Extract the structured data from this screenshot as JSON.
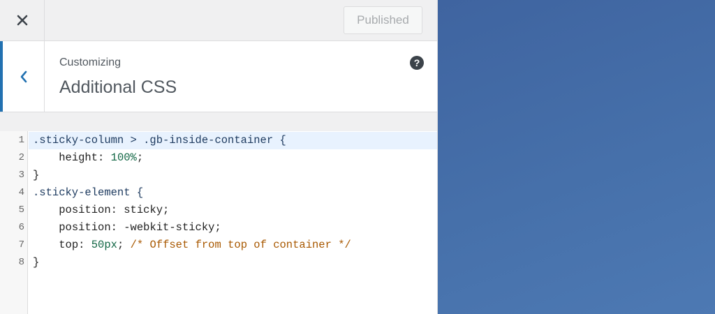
{
  "header": {
    "close_icon": "close-icon",
    "publish_label": "Published"
  },
  "section": {
    "back_icon": "chevron-left-icon",
    "customizing_label": "Customizing",
    "title": "Additional CSS",
    "help_icon": "help-icon",
    "help_glyph": "?"
  },
  "editor": {
    "lines": [
      {
        "num": "1",
        "indent": "",
        "tokens": [
          {
            "t": ".sticky-column > .gb-inside-container {",
            "c": "sel"
          }
        ]
      },
      {
        "num": "2",
        "indent": "    ",
        "tokens": [
          {
            "t": "height: ",
            "c": "prop"
          },
          {
            "t": "100%",
            "c": "num"
          },
          {
            "t": ";",
            "c": "plain"
          }
        ]
      },
      {
        "num": "3",
        "indent": "",
        "tokens": [
          {
            "t": "}",
            "c": "plain"
          }
        ]
      },
      {
        "num": "4",
        "indent": "",
        "tokens": [
          {
            "t": ".sticky-element {",
            "c": "sel"
          }
        ]
      },
      {
        "num": "5",
        "indent": "    ",
        "tokens": [
          {
            "t": "position: sticky;",
            "c": "prop"
          }
        ]
      },
      {
        "num": "6",
        "indent": "    ",
        "tokens": [
          {
            "t": "position: -webkit-sticky;",
            "c": "prop"
          }
        ]
      },
      {
        "num": "7",
        "indent": "    ",
        "tokens": [
          {
            "t": "top: ",
            "c": "prop"
          },
          {
            "t": "50px",
            "c": "num"
          },
          {
            "t": "; ",
            "c": "plain"
          },
          {
            "t": "/* Offset from top of container */",
            "c": "com"
          }
        ]
      },
      {
        "num": "8",
        "indent": "",
        "tokens": [
          {
            "t": "}",
            "c": "plain"
          }
        ]
      }
    ],
    "active_line": "1"
  },
  "colors": {
    "accent": "#2271b1",
    "preview_bg": "#4670aa"
  }
}
